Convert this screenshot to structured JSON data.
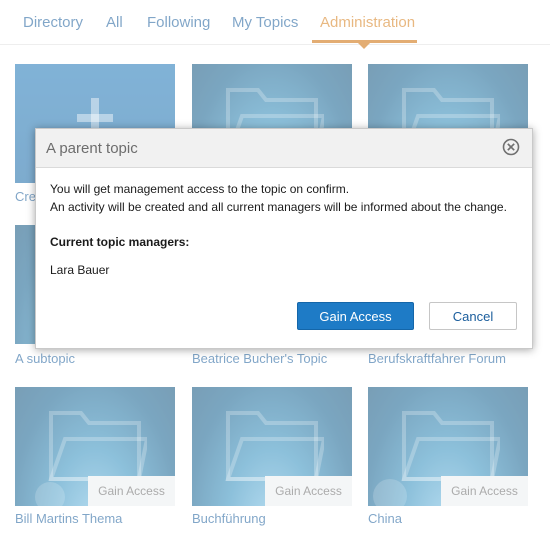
{
  "tabs": [
    "Directory",
    "All",
    "Following",
    "My Topics",
    "Administration"
  ],
  "active_tab": "Administration",
  "tiles": [
    {
      "label": "Cre",
      "gain_access": ""
    },
    {
      "label": "",
      "gain_access": ""
    },
    {
      "label": "",
      "gain_access": ""
    },
    {
      "label": "A subtopic",
      "gain_access": ""
    },
    {
      "label": "Beatrice Bucher's Topic",
      "gain_access": ""
    },
    {
      "label": "Berufskraftfahrer Forum",
      "gain_access": ""
    },
    {
      "label": "Bill Martins Thema",
      "gain_access": "Gain Access"
    },
    {
      "label": "Buchführung",
      "gain_access": "Gain Access"
    },
    {
      "label": "China",
      "gain_access": "Gain Access"
    }
  ],
  "dialog": {
    "title": "A parent topic",
    "message_line1": "You will get management access to the topic on confirm.",
    "message_line2": "An activity will be created and all current managers will be informed about the change.",
    "managers_heading": "Current topic managers:",
    "managers": [
      "Lara Bauer"
    ],
    "confirm_label": "Gain Access",
    "cancel_label": "Cancel"
  },
  "colors": {
    "link": "#1a5d9c",
    "active_tab": "#d67e1b",
    "primary_button": "#1e7bc6"
  }
}
